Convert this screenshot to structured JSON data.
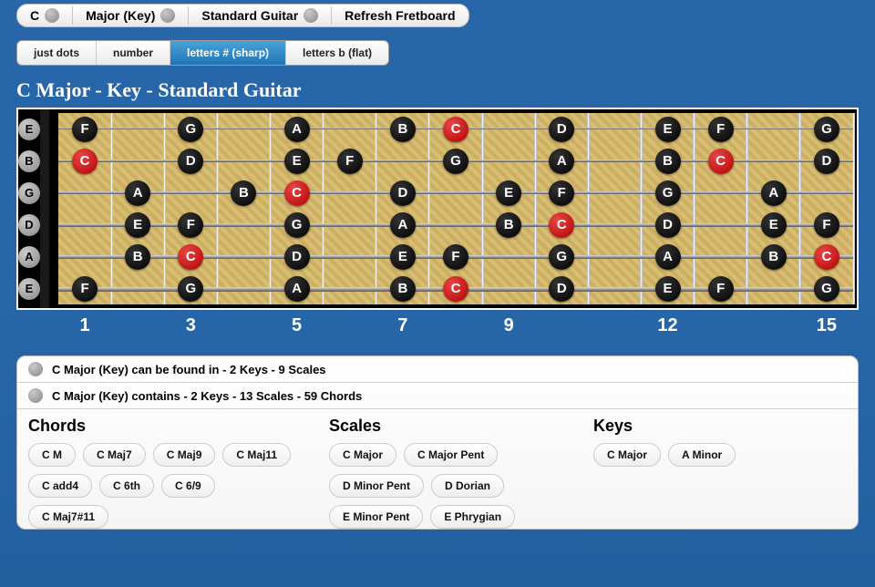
{
  "topbar": {
    "note": "C",
    "scale": "Major (Key)",
    "instrument": "Standard Guitar",
    "refresh": "Refresh Fretboard"
  },
  "tabs": {
    "just_dots": "just dots",
    "number": "number",
    "letters_sharp": "letters # (sharp)",
    "letters_flat": "letters b (flat)",
    "active": "letters_sharp"
  },
  "title": "C Major - Key - Standard Guitar",
  "fretboard": {
    "num_frets": 15,
    "fret_labels": [
      1,
      3,
      5,
      7,
      9,
      12,
      15
    ],
    "open_strings": [
      "E",
      "B",
      "G",
      "D",
      "A",
      "E"
    ],
    "scale_notes": [
      "C",
      "D",
      "E",
      "F",
      "G",
      "A",
      "B"
    ],
    "root": "C",
    "notes": [
      {
        "s": 0,
        "f": 1,
        "n": "F"
      },
      {
        "s": 0,
        "f": 3,
        "n": "G"
      },
      {
        "s": 0,
        "f": 5,
        "n": "A"
      },
      {
        "s": 0,
        "f": 7,
        "n": "B"
      },
      {
        "s": 0,
        "f": 8,
        "n": "C"
      },
      {
        "s": 0,
        "f": 10,
        "n": "D"
      },
      {
        "s": 0,
        "f": 12,
        "n": "E"
      },
      {
        "s": 0,
        "f": 13,
        "n": "F"
      },
      {
        "s": 0,
        "f": 15,
        "n": "G"
      },
      {
        "s": 1,
        "f": 1,
        "n": "C"
      },
      {
        "s": 1,
        "f": 3,
        "n": "D"
      },
      {
        "s": 1,
        "f": 5,
        "n": "E"
      },
      {
        "s": 1,
        "f": 6,
        "n": "F"
      },
      {
        "s": 1,
        "f": 8,
        "n": "G"
      },
      {
        "s": 1,
        "f": 10,
        "n": "A"
      },
      {
        "s": 1,
        "f": 12,
        "n": "B"
      },
      {
        "s": 1,
        "f": 13,
        "n": "C"
      },
      {
        "s": 1,
        "f": 15,
        "n": "D"
      },
      {
        "s": 2,
        "f": 2,
        "n": "A"
      },
      {
        "s": 2,
        "f": 4,
        "n": "B"
      },
      {
        "s": 2,
        "f": 5,
        "n": "C"
      },
      {
        "s": 2,
        "f": 7,
        "n": "D"
      },
      {
        "s": 2,
        "f": 9,
        "n": "E"
      },
      {
        "s": 2,
        "f": 10,
        "n": "F"
      },
      {
        "s": 2,
        "f": 12,
        "n": "G"
      },
      {
        "s": 2,
        "f": 14,
        "n": "A"
      },
      {
        "s": 3,
        "f": 2,
        "n": "E"
      },
      {
        "s": 3,
        "f": 3,
        "n": "F"
      },
      {
        "s": 3,
        "f": 5,
        "n": "G"
      },
      {
        "s": 3,
        "f": 7,
        "n": "A"
      },
      {
        "s": 3,
        "f": 9,
        "n": "B"
      },
      {
        "s": 3,
        "f": 10,
        "n": "C"
      },
      {
        "s": 3,
        "f": 12,
        "n": "D"
      },
      {
        "s": 3,
        "f": 14,
        "n": "E"
      },
      {
        "s": 3,
        "f": 15,
        "n": "F"
      },
      {
        "s": 4,
        "f": 2,
        "n": "B"
      },
      {
        "s": 4,
        "f": 3,
        "n": "C"
      },
      {
        "s": 4,
        "f": 5,
        "n": "D"
      },
      {
        "s": 4,
        "f": 7,
        "n": "E"
      },
      {
        "s": 4,
        "f": 8,
        "n": "F"
      },
      {
        "s": 4,
        "f": 10,
        "n": "G"
      },
      {
        "s": 4,
        "f": 12,
        "n": "A"
      },
      {
        "s": 4,
        "f": 14,
        "n": "B"
      },
      {
        "s": 4,
        "f": 15,
        "n": "C"
      },
      {
        "s": 5,
        "f": 1,
        "n": "F"
      },
      {
        "s": 5,
        "f": 3,
        "n": "G"
      },
      {
        "s": 5,
        "f": 5,
        "n": "A"
      },
      {
        "s": 5,
        "f": 7,
        "n": "B"
      },
      {
        "s": 5,
        "f": 8,
        "n": "C"
      },
      {
        "s": 5,
        "f": 10,
        "n": "D"
      },
      {
        "s": 5,
        "f": 12,
        "n": "E"
      },
      {
        "s": 5,
        "f": 13,
        "n": "F"
      },
      {
        "s": 5,
        "f": 15,
        "n": "G"
      }
    ]
  },
  "info": {
    "found_in": "C Major (Key) can be found in - 2 Keys - 9 Scales",
    "contains": "C Major (Key) contains - 2 Keys - 13 Scales - 59 Chords"
  },
  "sections": {
    "chords": {
      "title": "Chords",
      "items": [
        "C M",
        "C Maj7",
        "C Maj9",
        "C Maj11",
        "C add4",
        "C 6th",
        "C 6/9",
        "C Maj7#11"
      ]
    },
    "scales": {
      "title": "Scales",
      "items": [
        "C Major",
        "C Major Pent",
        "D Minor Pent",
        "D Dorian",
        "E Minor Pent",
        "E Phrygian"
      ]
    },
    "keys": {
      "title": "Keys",
      "items": [
        "C Major",
        "A Minor"
      ]
    }
  }
}
